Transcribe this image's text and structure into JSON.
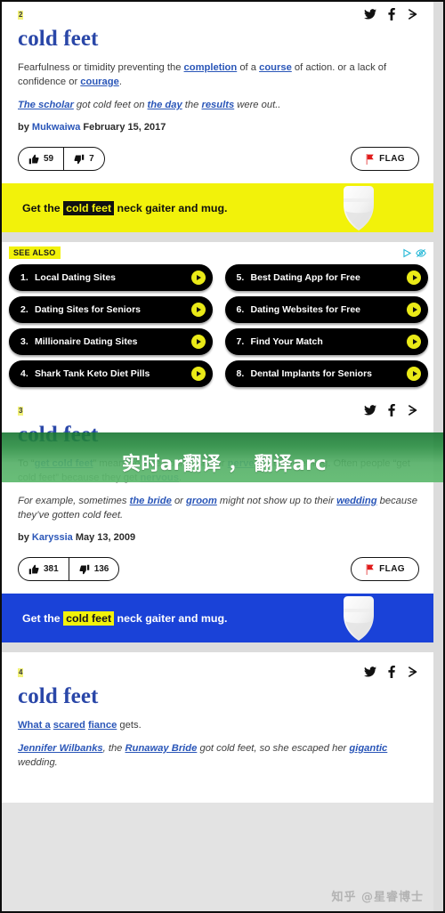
{
  "overlay": {
    "translated_text": "实时ar翻译 ， 翻译arc",
    "color": "#2a8c40"
  },
  "watermark": {
    "text": "知乎 @星睿博士"
  },
  "icons": {
    "twitter": "twitter-icon",
    "facebook": "facebook-icon",
    "share": "share-icon",
    "thumbs_up": "thumbs-up-icon",
    "thumbs_down": "thumbs-down-icon",
    "flag": "flag-icon",
    "adchoices": "adchoices-icon"
  },
  "entries": [
    {
      "index": "2",
      "term": "cold feet",
      "meaning_parts": [
        {
          "text": "Fearfulness or timidity preventing the ",
          "link": false
        },
        {
          "text": "completion",
          "link": true
        },
        {
          "text": " of a ",
          "link": false
        },
        {
          "text": "course",
          "link": true
        },
        {
          "text": " of action. or a lack of confidence or ",
          "link": false
        },
        {
          "text": "courage",
          "link": true
        },
        {
          "text": ".",
          "link": false
        }
      ],
      "example_parts": [
        {
          "text": "The scholar",
          "link": true
        },
        {
          "text": " got cold feet on ",
          "link": false
        },
        {
          "text": "the day",
          "link": true
        },
        {
          "text": " the ",
          "link": false
        },
        {
          "text": "results",
          "link": true
        },
        {
          "text": " were out..",
          "link": false
        }
      ],
      "by_prefix": "by ",
      "author": "Mukwaiwa",
      "date": "February 15, 2017",
      "upvotes": "59",
      "downvotes": "7",
      "flag_label": "FLAG"
    },
    {
      "index": "3",
      "term": "cold feet",
      "meaning_parts": [
        {
          "text": "To “",
          "link": false
        },
        {
          "text": "get cold feet",
          "link": true
        },
        {
          "text": "” means to lose your desire or ",
          "link": false
        },
        {
          "text": "nerve",
          "link": true
        },
        {
          "text": " to do something. Often people “get cold feet” because they get ",
          "link": false
        },
        {
          "text": "nervous",
          "link": true
        },
        {
          "text": ".",
          "link": false
        }
      ],
      "example_parts": [
        {
          "text": "For example, sometimes ",
          "link": false
        },
        {
          "text": "the bride",
          "link": true
        },
        {
          "text": " or ",
          "link": false
        },
        {
          "text": "groom",
          "link": true
        },
        {
          "text": " might not show up to their ",
          "link": false
        },
        {
          "text": "wedding",
          "link": true
        },
        {
          "text": " because they’ve gotten cold feet.",
          "link": false
        }
      ],
      "by_prefix": "by ",
      "author": "Karyssia",
      "date": "May 13, 2009",
      "upvotes": "381",
      "downvotes": "136",
      "flag_label": "FLAG"
    },
    {
      "index": "4",
      "term": "cold feet",
      "meaning_parts": [
        {
          "text": "What a",
          "link": true
        },
        {
          "text": " ",
          "link": false
        },
        {
          "text": "scared",
          "link": true
        },
        {
          "text": " ",
          "link": false
        },
        {
          "text": "fiance",
          "link": true
        },
        {
          "text": " gets.",
          "link": false
        }
      ],
      "example_parts": [
        {
          "text": "Jennifer Wilbanks",
          "link": true
        },
        {
          "text": ", the ",
          "link": false
        },
        {
          "text": "Runaway Bride",
          "link": true
        },
        {
          "text": " got cold feet, so she escaped her ",
          "link": false
        },
        {
          "text": "gigantic",
          "link": true
        },
        {
          "text": " wedding.",
          "link": false
        }
      ]
    }
  ],
  "merch_banners": [
    {
      "prefix": "Get the ",
      "highlight": "cold feet",
      "suffix": " neck gaiter and mug.",
      "bg": "#f2f20a",
      "style": "yellow"
    },
    {
      "prefix": "Get the ",
      "highlight": "cold feet",
      "suffix": " neck gaiter and mug.",
      "bg": "#1a42d8",
      "style": "blue"
    }
  ],
  "see_also": {
    "label": "SEE ALSO",
    "items": [
      {
        "num": "1.",
        "title": "Local Dating Sites"
      },
      {
        "num": "5.",
        "title": "Best Dating App for Free"
      },
      {
        "num": "2.",
        "title": "Dating Sites for Seniors"
      },
      {
        "num": "6.",
        "title": "Dating Websites for Free"
      },
      {
        "num": "3.",
        "title": "Millionaire Dating Sites"
      },
      {
        "num": "7.",
        "title": "Find Your Match"
      },
      {
        "num": "4.",
        "title": "Shark Tank Keto Diet Pills"
      },
      {
        "num": "8.",
        "title": "Dental Implants for Seniors"
      }
    ]
  }
}
